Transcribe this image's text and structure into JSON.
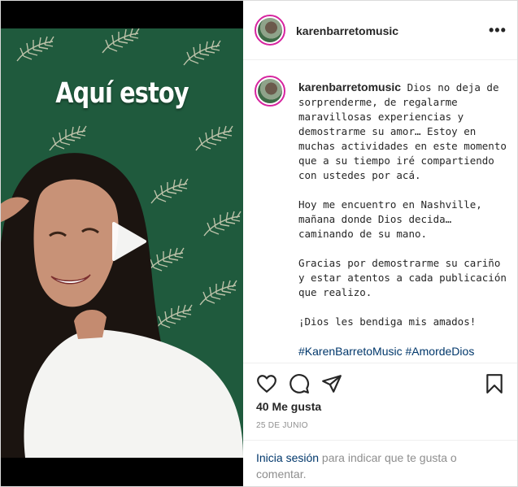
{
  "post": {
    "username": "karenbarretomusic",
    "more_icon": "more-horizontal-icon"
  },
  "media": {
    "title_overlay": "Aquí estoy",
    "play_icon": "play-icon"
  },
  "caption": {
    "username": "karenbarretomusic",
    "text": "Dios no deja de sorprenderme, de regalarme maravillosas experiencias y demostrarme su amor… Estoy en muchas actividades en este momento que a su tiempo iré compartiendo con ustedes por acá.\n\nHoy me encuentro en Nashville, mañana donde Dios decida… caminando de su mano.\n\nGracias por demostrarme su cariño y estar atentos a cada publicación que realizo.\n\n¡Dios les bendiga mis amados!\n\n",
    "hashtags": "#KarenBarretoMusic #AmordeDios"
  },
  "actions": {
    "icons": [
      "heart-icon",
      "comment-icon",
      "share-icon",
      "save-icon"
    ],
    "likes": "40 Me gusta",
    "date": "25 DE JUNIO"
  },
  "footer": {
    "login_link": "Inicia sesión",
    "login_rest": " para indicar que te gusta o comentar."
  },
  "colors": {
    "background_green": "#1f5a3d",
    "link": "#00376b",
    "avatar_ring": "#d6249f"
  }
}
